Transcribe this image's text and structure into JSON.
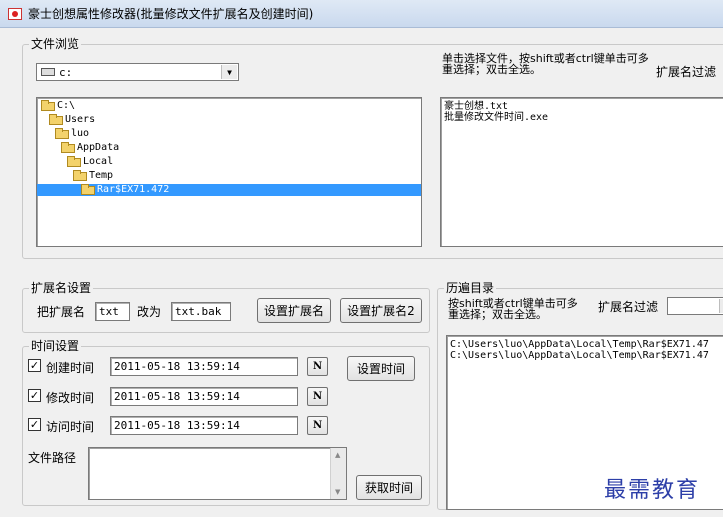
{
  "window": {
    "title": "豪士创想属性修改器(批量修改文件扩展名及创建时间)"
  },
  "browse": {
    "group_label": "文件浏览",
    "drive_value": "c:",
    "hint": "单击选择文件，按shift或者ctrl键单击可多重选择；双击全选。",
    "ext_filter_label": "扩展名过滤",
    "tree": [
      {
        "label": "C:\\"
      },
      {
        "label": "Users"
      },
      {
        "label": "luo"
      },
      {
        "label": "AppData"
      },
      {
        "label": "Local"
      },
      {
        "label": "Temp"
      },
      {
        "label": "Rar$EX71.472"
      }
    ],
    "files": [
      "豪士创想.txt",
      "批量修改文件时间.exe"
    ]
  },
  "ext_settings": {
    "group_label": "扩展名设置",
    "from_label": "把扩展名",
    "from_value": "txt",
    "to_label": "改为",
    "to_value": "txt.bak",
    "set_button": "设置扩展名",
    "set_button2": "设置扩展名2"
  },
  "time_settings": {
    "group_label": "时间设置",
    "rows": [
      {
        "label": "创建时间",
        "value": "2011-05-18 13:59:14",
        "n": "N",
        "checked": "✓"
      },
      {
        "label": "修改时间",
        "value": "2011-05-18 13:59:14",
        "n": "N",
        "checked": "✓"
      },
      {
        "label": "访问时间",
        "value": "2011-05-18 13:59:14",
        "n": "N",
        "checked": "✓"
      }
    ],
    "set_time_button": "设置时间",
    "path_label": "文件路径",
    "get_time_button": "获取时间"
  },
  "history": {
    "group_label": "历遍目录",
    "hint": "按shift或者ctrl键单击可多重选择；双击全选。",
    "ext_filter_label": "扩展名过滤",
    "items": [
      "C:\\Users\\luo\\AppData\\Local\\Temp\\Rar$EX71.47",
      "C:\\Users\\luo\\AppData\\Local\\Temp\\Rar$EX71.47"
    ]
  },
  "watermark": "最需教育",
  "icons": {
    "drive": "drive-icon",
    "folder": "folder-icon",
    "dropdown": "chevron-down-icon"
  }
}
